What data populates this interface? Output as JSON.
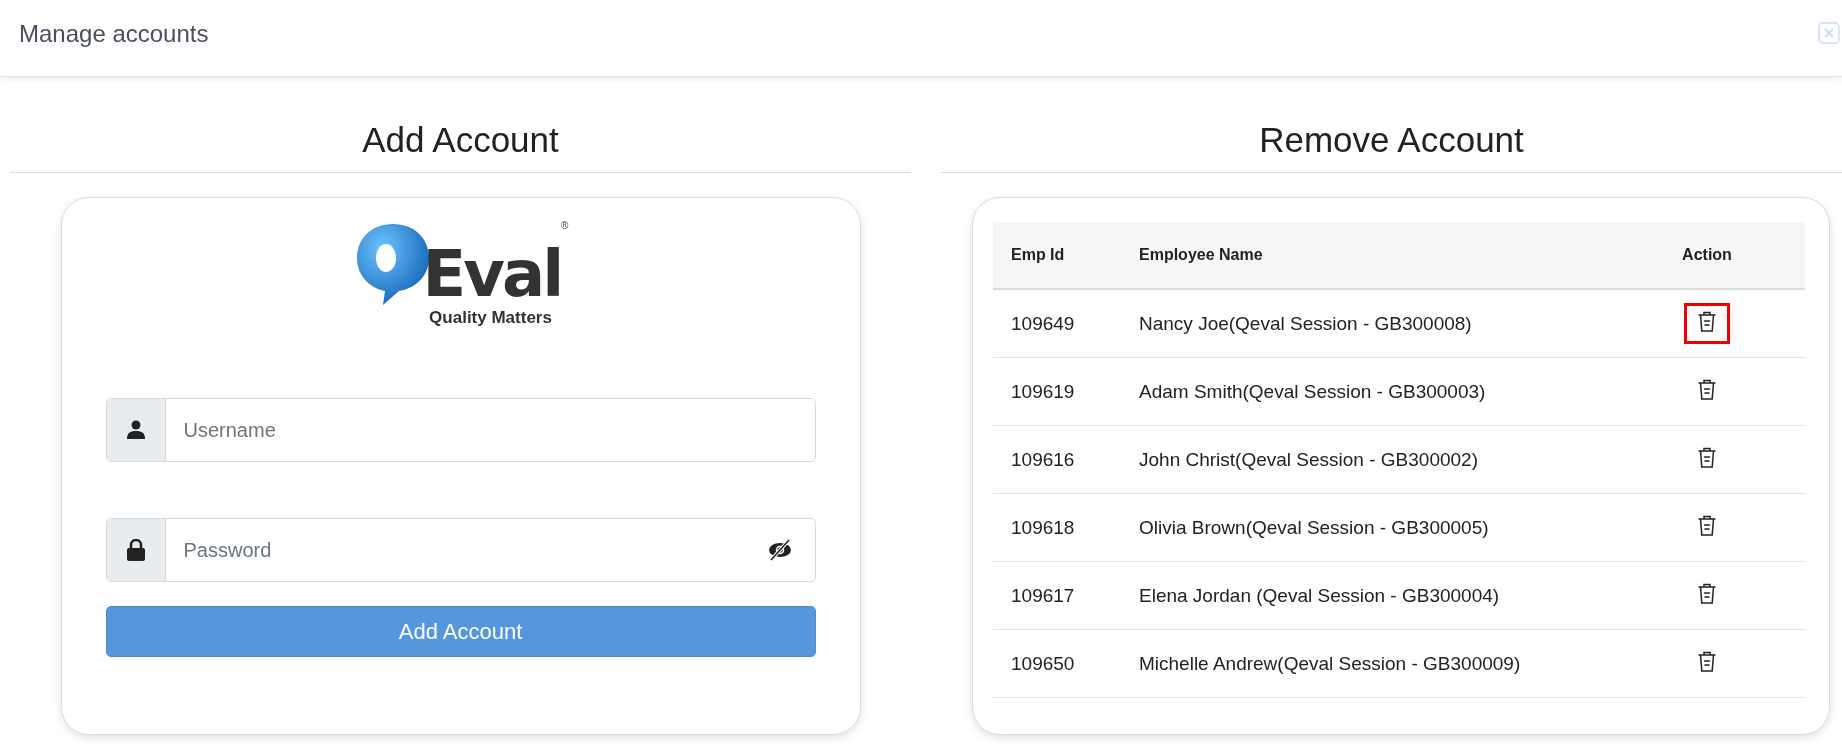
{
  "window": {
    "title": "Manage accounts"
  },
  "add_account": {
    "heading": "Add Account",
    "logo": {
      "name": "Eval",
      "registered": "®",
      "tagline": "Quality Matters"
    },
    "username": {
      "placeholder": "Username"
    },
    "password": {
      "placeholder": "Password",
      "visible": false
    },
    "submit": "Add Account"
  },
  "remove_account": {
    "heading": "Remove Account",
    "table": {
      "columns": [
        "Emp Id",
        "Employee Name",
        "Action"
      ],
      "rows": [
        {
          "emp_id": "109649",
          "name": "Nancy Joe(Qeval Session - GB300008)",
          "highlighted": true
        },
        {
          "emp_id": "109619",
          "name": "Adam Smith(Qeval Session - GB300003)",
          "highlighted": false
        },
        {
          "emp_id": "109616",
          "name": "John Christ(Qeval Session - GB300002)",
          "highlighted": false
        },
        {
          "emp_id": "109618",
          "name": "Olivia Brown(Qeval Session - GB300005)",
          "highlighted": false
        },
        {
          "emp_id": "109617",
          "name": "Elena Jordan (Qeval Session - GB300004)",
          "highlighted": false
        },
        {
          "emp_id": "109650",
          "name": "Michelle Andrew(Qeval Session - GB300009)",
          "highlighted": false
        }
      ]
    }
  }
}
